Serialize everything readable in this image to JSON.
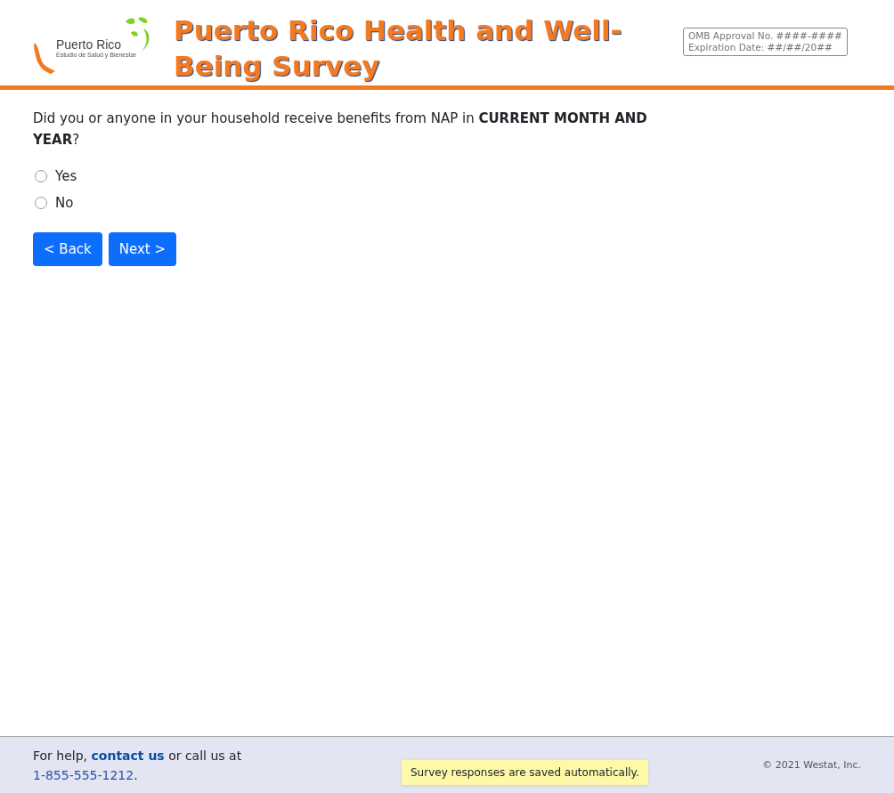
{
  "header": {
    "logo": {
      "name": "Puerto Rico",
      "tagline": "Estudio de Salud y Bienestar"
    },
    "title": "Puerto Rico Health and Well-Being Survey",
    "omb": {
      "approval": "OMB Approval No. ####-####",
      "expiration": "Expiration Date: ##/##/20##"
    }
  },
  "question": {
    "text": "Did you or anyone in your household receive benefits from NAP in **CURRENT MONTH AND YEAR**?",
    "options": [
      {
        "label": "Yes",
        "selected": false
      },
      {
        "label": "No",
        "selected": false
      }
    ]
  },
  "buttons": [
    {
      "label": "< Back"
    },
    {
      "label": "Next >"
    }
  ],
  "footer": {
    "help_before": "For help,",
    "help_link": "contact us",
    "help_middle": "or call us at",
    "phone": "1-855-555-1212",
    "help_end": ".",
    "saved_notice": "Survey responses are saved automatically.",
    "copyright": "© 2021 Westat, Inc."
  }
}
